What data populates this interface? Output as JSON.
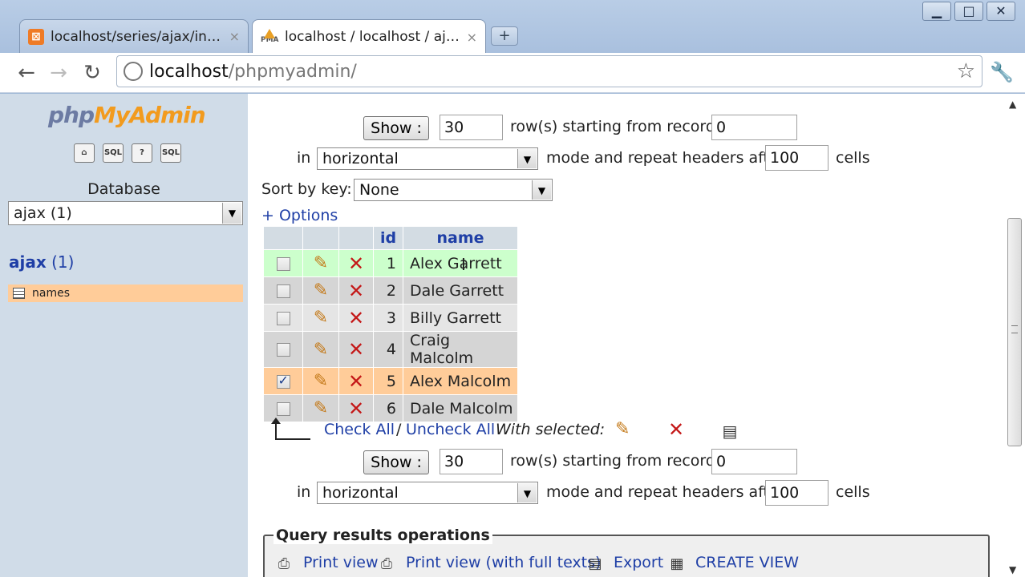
{
  "browser": {
    "window_controls": {
      "minimize": "▁",
      "maximize": "□",
      "close": "✕"
    },
    "tabs": [
      {
        "title": "localhost/series/ajax/ind...",
        "favicon": "xampp-icon",
        "close": "×"
      },
      {
        "title": "localhost / localhost / aja...",
        "favicon": "pma-icon",
        "close": "×"
      }
    ],
    "new_tab": "+",
    "url_host": "localhost",
    "url_path": "/phpmyadmin/"
  },
  "left": {
    "logo_php": "php",
    "logo_myadmin": "MyAdmin",
    "icons": [
      "home-icon",
      "sql-icon",
      "help-icon",
      "sql-query-icon"
    ],
    "icon_labels": [
      "⌂",
      "SQL",
      "?",
      "SQL"
    ],
    "database_label": "Database",
    "database_select": "ajax (1)",
    "db_name": "ajax",
    "db_count": "(1)",
    "table_name": "names"
  },
  "nav_top": {
    "show_button": "Show :",
    "rows_value": "30",
    "rows_text": "row(s) starting from record #",
    "start_value": "0",
    "in_text": "in",
    "mode_value": "horizontal",
    "repeat_text": "mode and repeat headers after",
    "repeat_value": "100",
    "cells_text": "cells"
  },
  "sort": {
    "label": "Sort by key:",
    "value": "None"
  },
  "options_link": "+ Options",
  "results": {
    "headers": [
      "id",
      "name"
    ],
    "rows": [
      {
        "id": "1",
        "name": "Alex Garrett",
        "checked": false
      },
      {
        "id": "2",
        "name": "Dale Garrett",
        "checked": false
      },
      {
        "id": "3",
        "name": "Billy Garrett",
        "checked": false
      },
      {
        "id": "4",
        "name": "Craig Malcolm",
        "checked": false
      },
      {
        "id": "5",
        "name": "Alex Malcolm",
        "checked": true
      },
      {
        "id": "6",
        "name": "Dale Malcolm",
        "checked": false
      }
    ]
  },
  "bulk": {
    "check_all": "Check All",
    "separator": "/",
    "uncheck_all": "Uncheck All",
    "with_selected": "With selected:"
  },
  "nav_bottom": {
    "show_button": "Show :",
    "rows_value": "30",
    "rows_text": "row(s) starting from record #",
    "start_value": "0",
    "in_text": "in",
    "mode_value": "horizontal",
    "repeat_text": "mode and repeat headers after",
    "repeat_value": "100",
    "cells_text": "cells"
  },
  "query_ops": {
    "legend": "Query results operations",
    "links": [
      "Print view",
      "Print view (with full texts)",
      "Export",
      "CREATE VIEW"
    ]
  },
  "colors": {
    "link": "#1f3fa6",
    "row_hover": "#ccffcc",
    "row_marked": "#ffcc99",
    "left_bg": "#d0dce8"
  }
}
